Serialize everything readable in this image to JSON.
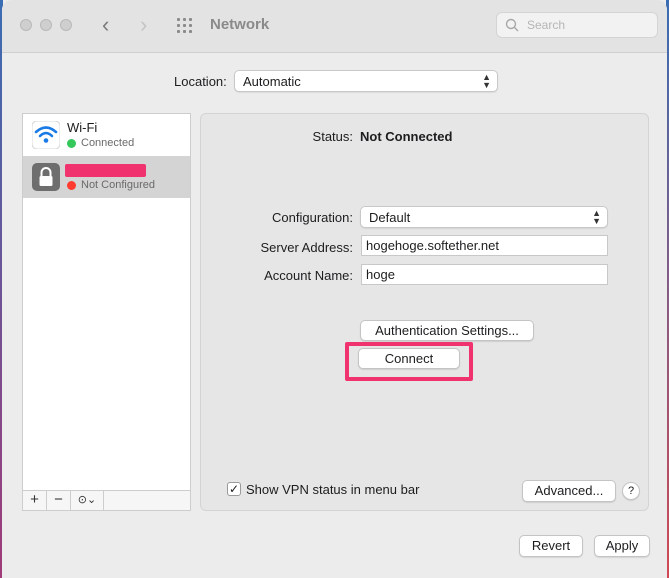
{
  "window": {
    "title": "Network"
  },
  "search": {
    "placeholder": "Search"
  },
  "location": {
    "label": "Location:",
    "value": "Automatic"
  },
  "services": [
    {
      "name": "Wi-Fi",
      "status": "Connected",
      "status_color": "#34c759",
      "icon": "wifi-icon"
    },
    {
      "name": "",
      "status": "Not Configured",
      "status_color": "#ff3b30",
      "icon": "lock-icon"
    }
  ],
  "sidebar_toolbar": {
    "add": "+",
    "remove": "−",
    "actions": "⊙⌄"
  },
  "details": {
    "status_label": "Status:",
    "status_value": "Not Connected",
    "configuration_label": "Configuration:",
    "configuration_value": "Default",
    "server_label": "Server Address:",
    "server_value": "hogehoge.softether.net",
    "account_label": "Account Name:",
    "account_value": "hoge",
    "auth_button": "Authentication Settings...",
    "connect_button": "Connect",
    "show_vpn_label": "Show VPN status in menu bar",
    "show_vpn_checked": "✓",
    "advanced_button": "Advanced...",
    "help": "?"
  },
  "footer": {
    "revert": "Revert",
    "apply": "Apply"
  },
  "colors": {
    "highlight": "#f0336e"
  }
}
